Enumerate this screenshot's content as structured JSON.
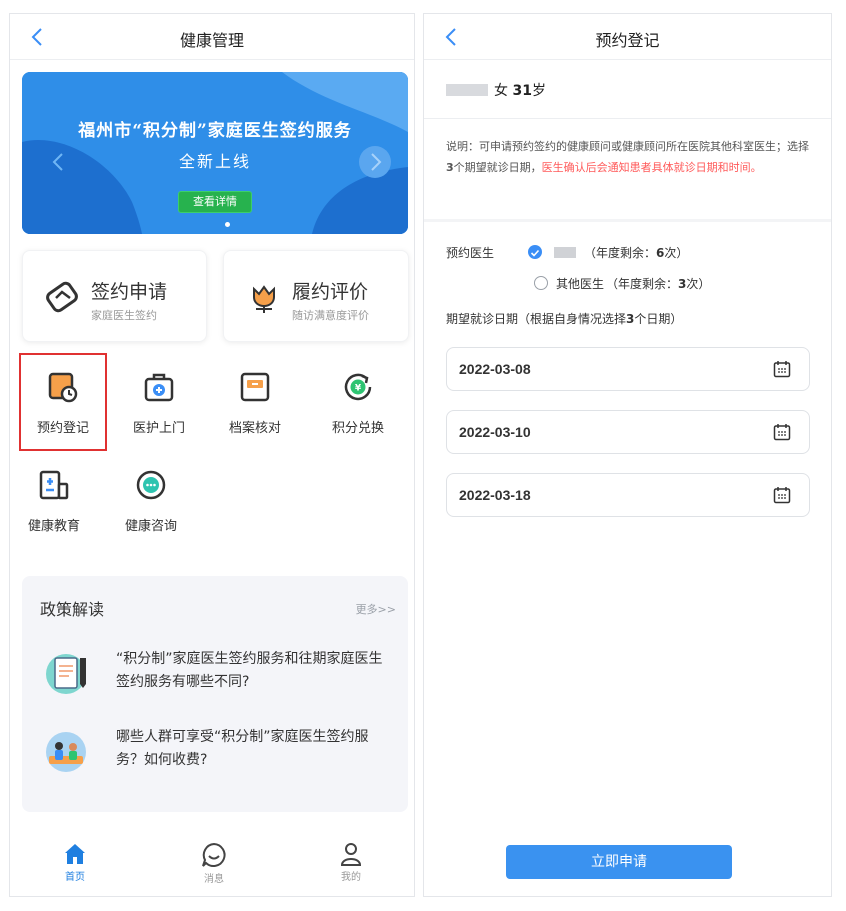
{
  "left": {
    "title": "健康管理",
    "banner": {
      "title": "福州市“积分制”家庭医生签约服务",
      "subtitle": "全新上线",
      "button": "查看详情"
    },
    "cards": [
      {
        "title": "签约申请",
        "sub": "家庭医生签约",
        "icon": "handshake-icon"
      },
      {
        "title": "履约评价",
        "sub": "随访满意度评价",
        "icon": "flower-icon"
      }
    ],
    "grid": [
      {
        "label": "预约登记",
        "icon": "calendar-clock-icon"
      },
      {
        "label": "医护上门",
        "icon": "medical-kit-icon"
      },
      {
        "label": "档案核对",
        "icon": "archive-icon"
      },
      {
        "label": "积分兑换",
        "icon": "points-exchange-icon"
      },
      {
        "label": "健康教育",
        "icon": "education-book-icon"
      },
      {
        "label": "健康咨询",
        "icon": "chat-icon"
      }
    ],
    "policy": {
      "title": "政策解读",
      "more": "更多>>",
      "items": [
        {
          "text": "“积分制”家庭医生签约服务和往期家庭医生签约服务有哪些不同?"
        },
        {
          "text": "哪些人群可享受“积分制”家庭医生签约服务？如何收费?"
        }
      ]
    },
    "tabs": [
      {
        "label": "首页",
        "icon": "home-icon"
      },
      {
        "label": "消息",
        "icon": "message-icon"
      },
      {
        "label": "我的",
        "icon": "user-icon"
      }
    ]
  },
  "right": {
    "title": "预约登记",
    "patient": {
      "gender": "女",
      "age_num": "31",
      "age_unit": "岁"
    },
    "note": {
      "prefix": "说明：可申请预约签约的健康顾问或健康顾问所在医院其他科室医生；选择",
      "num": "3",
      "middle": "个期望就诊日期，",
      "red": "医生确认后会通知患者具体就诊日期和时间。"
    },
    "doctor_label": "预约医生",
    "doctor1": {
      "pre": "（年度剩余：",
      "num": "6",
      "post": "次）"
    },
    "doctor2": {
      "name": "其他医生",
      "pre": "（年度剩余：",
      "num": "3",
      "post": "次）"
    },
    "date_label_pre": "期望就诊日期（根据自身情况选择",
    "date_label_num": "3",
    "date_label_post": "个日期）",
    "dates": [
      "2022-03-08",
      "2022-03-10",
      "2022-03-18"
    ],
    "submit": "立即申请"
  },
  "colors": {
    "primary": "#3a92f0",
    "highlight": "#e03131",
    "warning": "#ff5a5a"
  }
}
